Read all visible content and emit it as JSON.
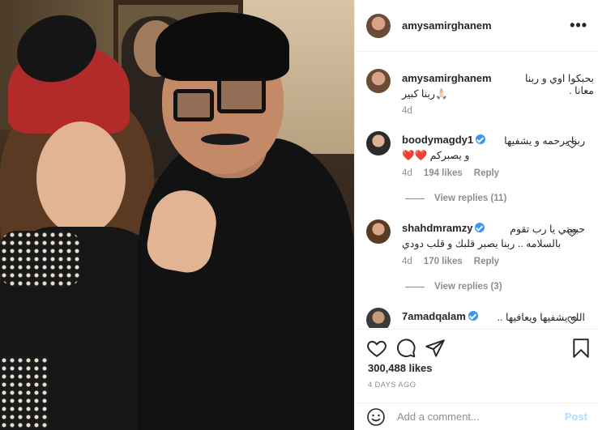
{
  "post": {
    "username": "amysamirghanem",
    "more_label": "•••",
    "caption": {
      "username": "amysamirghanem",
      "text_line1": "بحبكوا اوي و ربنا معانا .",
      "text_line2": "🙏🏻ربنا كبير",
      "age": "4d"
    },
    "comments": [
      {
        "username": "boodymagdy1",
        "verified": true,
        "text_line1": "ربنا يرحمه و يشفيها",
        "text_line2": "و يصبركم ❤️❤️",
        "age": "4d",
        "likes": "194 likes",
        "reply": "Reply",
        "view_replies": "View replies (11)"
      },
      {
        "username": "shahdmramzy",
        "verified": true,
        "text_line1": "حبيبتي يا رب تقوم",
        "text_line2": "بالسلامه .. ربنا يصبر قلبك و قلب دودي",
        "age": "4d",
        "likes": "170 likes",
        "reply": "Reply",
        "view_replies": "View replies (3)"
      },
      {
        "username": "7amadqalam",
        "verified": true,
        "text_line1": "الله يشفيها ويعافيها ..",
        "text_line2": ""
      }
    ],
    "likes_count": "300,488 likes",
    "date": "4 DAYS AGO",
    "add_comment_placeholder": "Add a comment...",
    "post_button": "Post"
  },
  "colors": {
    "text": "#262626",
    "muted": "#8e8e8e",
    "verified": "#3897f0",
    "post_disabled": "#b3dbff",
    "border": "#efefef"
  },
  "icons": [
    "heart-icon",
    "comment-icon",
    "share-icon",
    "bookmark-icon",
    "emoji-icon",
    "more-icon",
    "verified-icon"
  ]
}
